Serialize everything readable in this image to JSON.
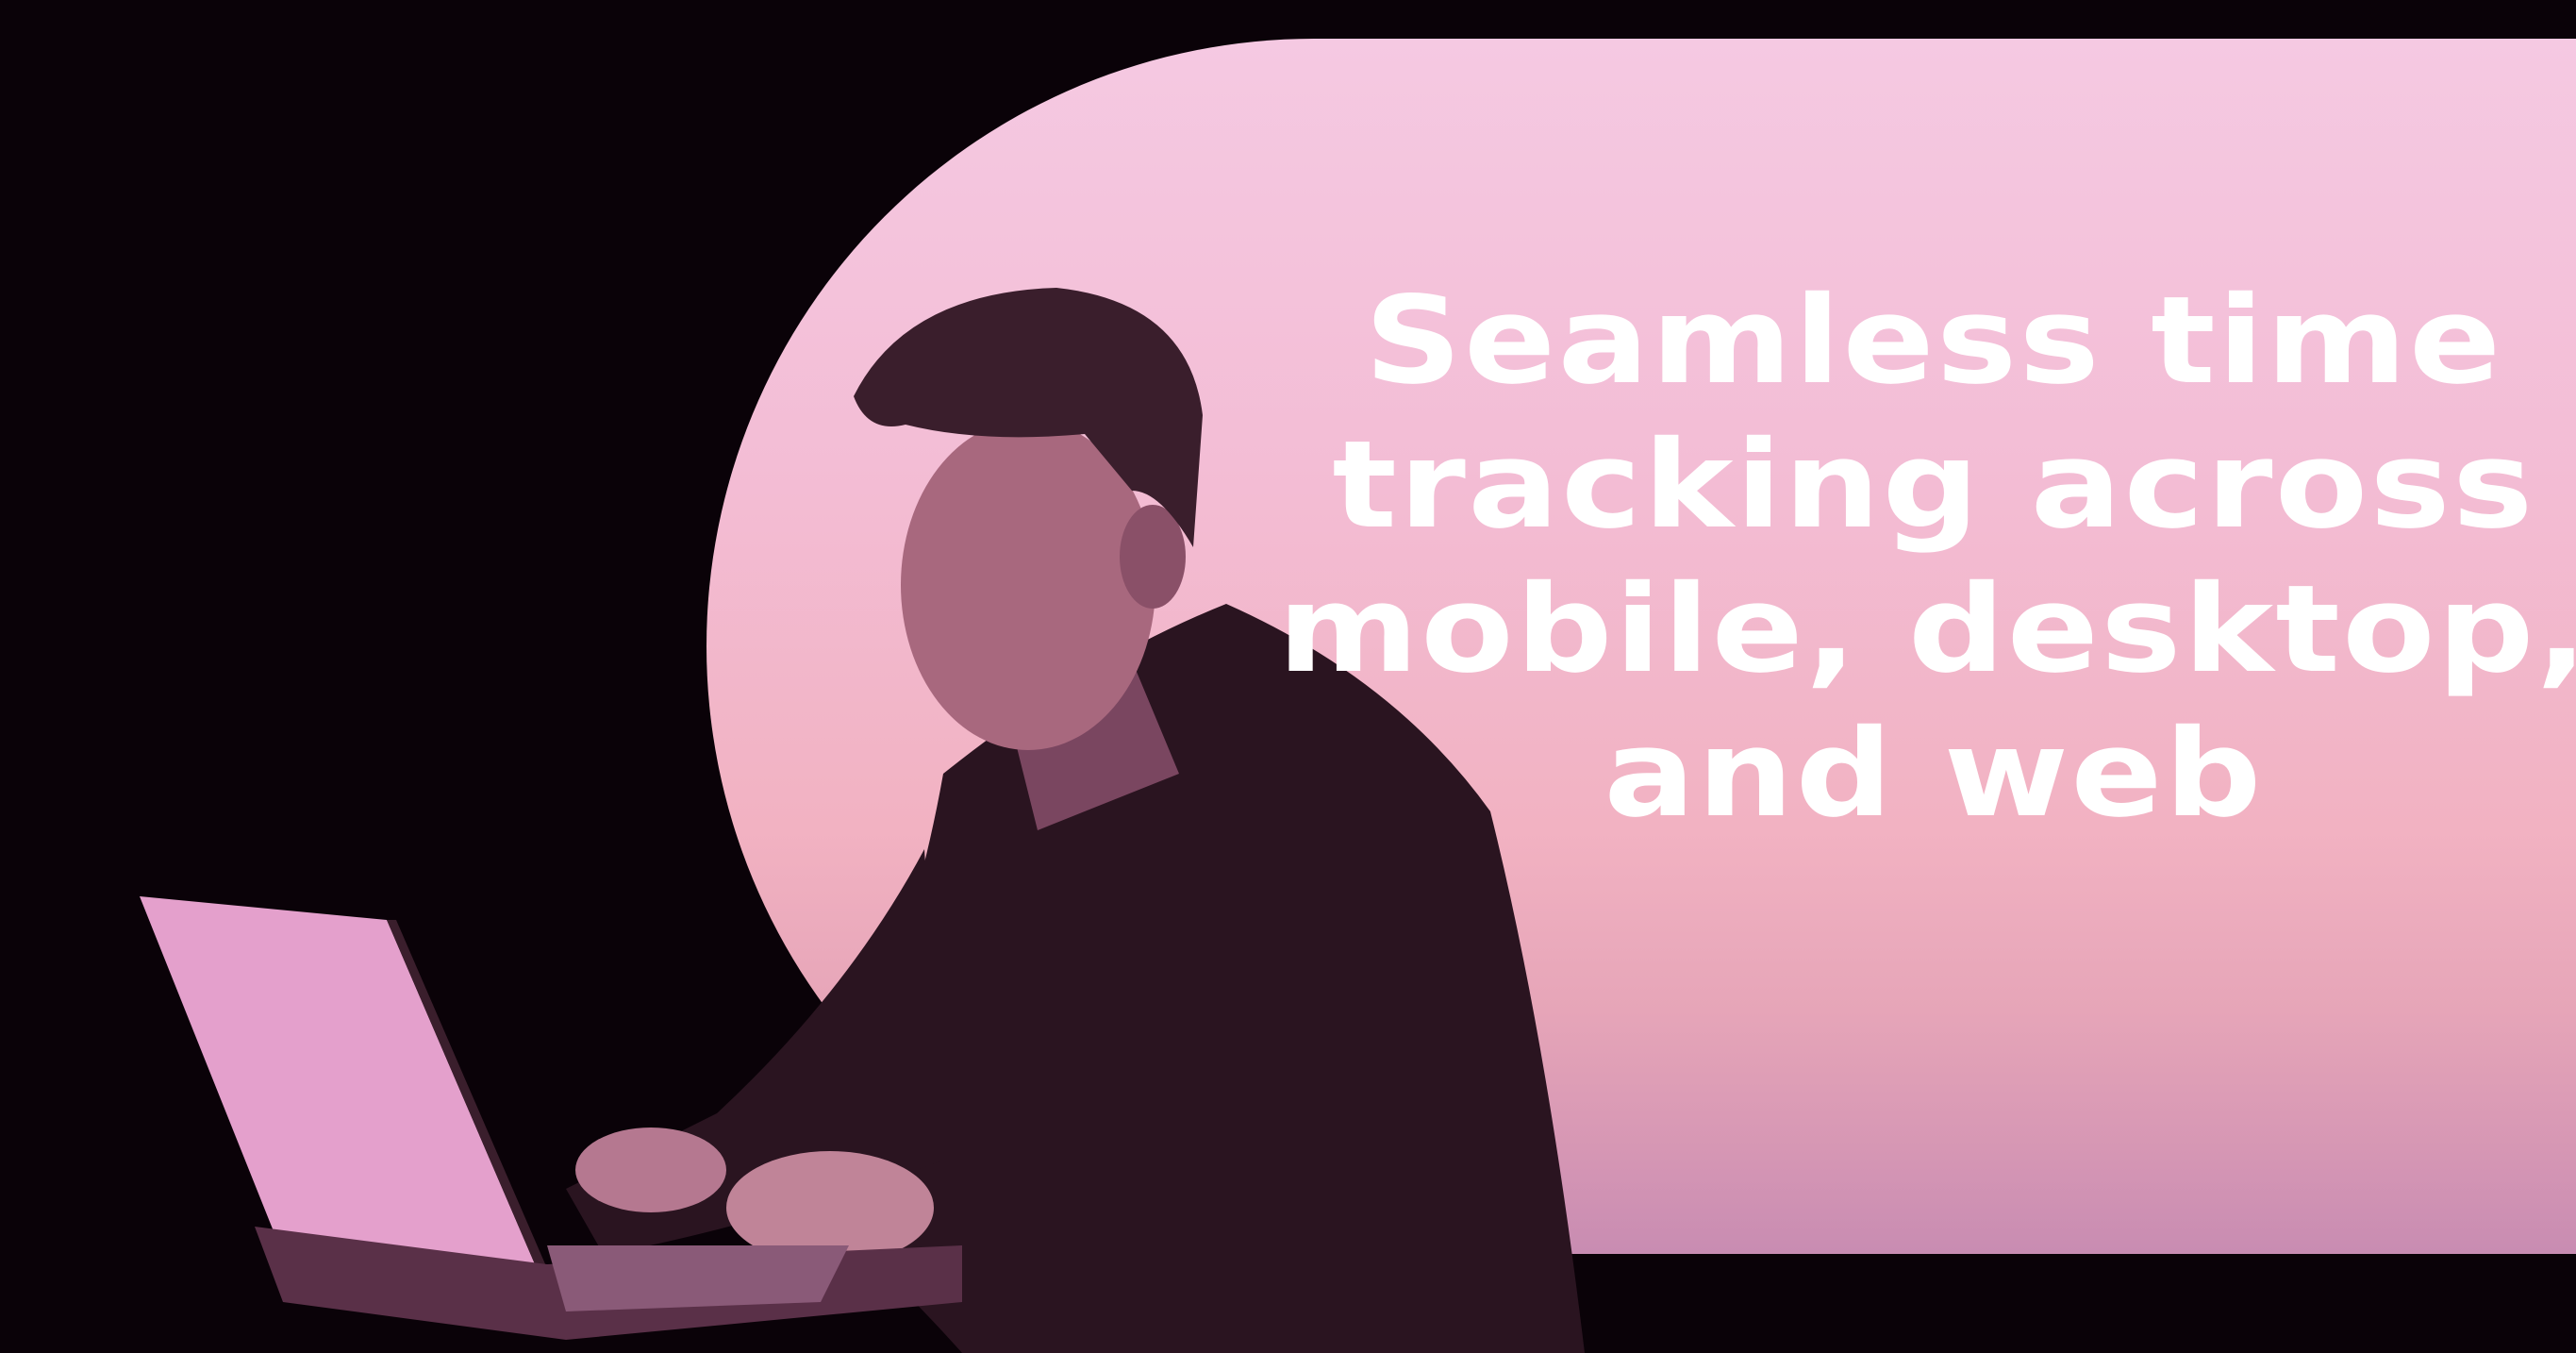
{
  "headline": {
    "lines": [
      "Seamless time",
      "tracking across",
      "mobile, desktop,",
      "and web"
    ]
  },
  "colors": {
    "background": "#0a0208",
    "banner_top": "#f5c9e2",
    "banner_bottom": "#c88cb2",
    "text": "#ffffff"
  }
}
